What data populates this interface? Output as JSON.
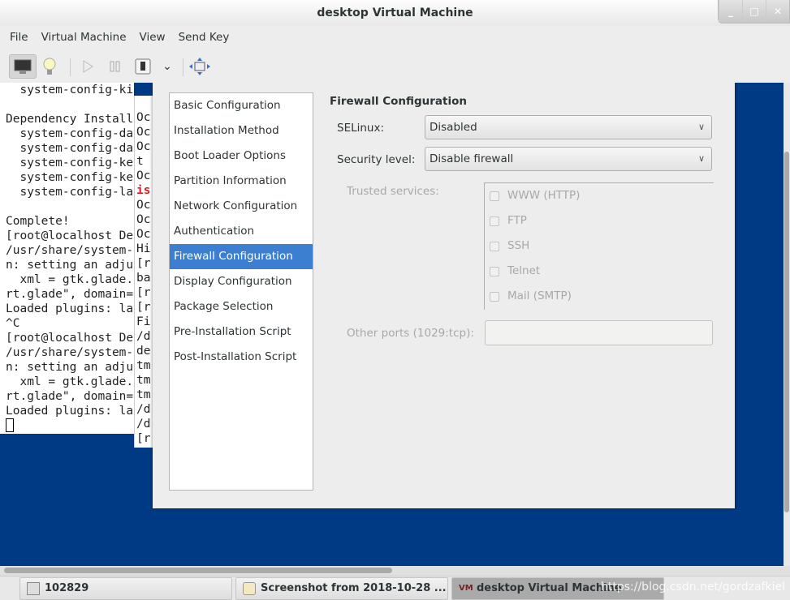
{
  "window": {
    "title": "desktop Virtual Machine",
    "controls": {
      "minimize": "_",
      "maximize": "□",
      "close": "✕"
    }
  },
  "menu": [
    "File",
    "Virtual Machine",
    "View",
    "Send Key"
  ],
  "toolbar": {
    "icons": [
      "monitor-icon",
      "lightbulb-icon",
      "play-icon",
      "pause-icon",
      "power-icon",
      "chevron-down-icon",
      "fullscreen-icon"
    ]
  },
  "terminal1": {
    "lines": [
      "  system-config-ki",
      "",
      "Dependency Install",
      "  system-config-da",
      "  system-config-da",
      "  system-config-ke",
      "  system-config-ke",
      "  system-config-la",
      "",
      "Complete!",
      "[root@localhost De",
      "/usr/share/system-",
      "n: setting an adju",
      "  xml = gtk.glade.",
      "rt.glade\", domain=",
      "Loaded plugins: la",
      "^C",
      "[root@localhost De",
      "/usr/share/system-",
      "n: setting an adju",
      "  xml = gtk.glade.",
      "rt.glade\", domain=",
      "Loaded plugins: la"
    ]
  },
  "terminal2": {
    "lines": [
      "",
      "Oc",
      "Oc",
      "Oc",
      "t :",
      "Oc",
      "is",
      "Oc",
      "Oc",
      "Oc",
      "Hi",
      "[r",
      "ba",
      "[r",
      "[r",
      "Fi",
      "/d",
      "de",
      "tm",
      "tm",
      "tm",
      "/d",
      "/d",
      "[r"
    ],
    "highlight_color": "#e01b24"
  },
  "nav": {
    "items": [
      "Basic Configuration",
      "Installation Method",
      "Boot Loader Options",
      "Partition Information",
      "Network Configuration",
      "Authentication",
      "Firewall Configuration",
      "Display Configuration",
      "Package Selection",
      "Pre-Installation Script",
      "Post-Installation Script"
    ],
    "selected": "Firewall Configuration"
  },
  "firewall": {
    "heading": "Firewall Configuration",
    "selinux_label": "SELinux:",
    "selinux_value": "Disabled",
    "security_label": "Security level:",
    "security_value": "Disable firewall",
    "trusted_label": "Trusted services:",
    "services": [
      "WWW (HTTP)",
      "FTP",
      "SSH",
      "Telnet",
      "Mail (SMTP)"
    ],
    "other_ports_label": "Other ports (1029:tcp):",
    "other_ports_value": ""
  },
  "taskbar": {
    "items": [
      "102829",
      "Screenshot from 2018-10-28 ...",
      "desktop Virtual Machine"
    ],
    "watermark": "https://blog.csdn.net/gordzafkiel"
  },
  "colors": {
    "vm_background": "#003a85",
    "selection": "#3c7fd1"
  }
}
